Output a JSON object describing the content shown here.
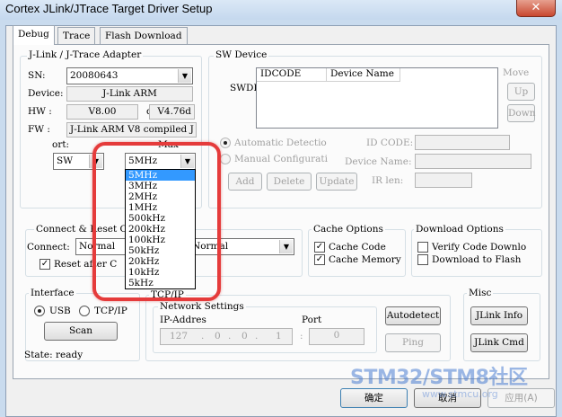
{
  "window": {
    "title": "Cortex JLink/JTrace Target Driver Setup",
    "close_glyph": "✕"
  },
  "tabs": [
    {
      "label": "Debug",
      "active": true
    },
    {
      "label": "Trace",
      "active": false
    },
    {
      "label": "Flash Download",
      "active": false
    }
  ],
  "adapter": {
    "title": "J-Link / J-Trace Adapter",
    "sn_label": "SN:",
    "sn_value": "20080643",
    "device_label": "Device:",
    "device_value": "J-Link ARM",
    "hw_label": "HW :",
    "hw_value": "V8.00",
    "dll_label": "dll",
    "dll_value": "V4.76d",
    "fw_label": "FW :",
    "fw_value": "J-Link ARM V8 compiled J",
    "port_label": "ort:",
    "port_value": "SW",
    "max_label": "Max",
    "max_value": "5MHz"
  },
  "clock_dropdown": {
    "options": [
      "5MHz",
      "3MHz",
      "2MHz",
      "1MHz",
      "500kHz",
      "200kHz",
      "100kHz",
      "50kHz",
      "20kHz",
      "10kHz",
      "5kHz"
    ],
    "selected": "5MHz"
  },
  "sw_device": {
    "title": "SW Device",
    "swdi_label": "SWDI",
    "col_idcode": "IDCODE",
    "col_device_name": "Device Name",
    "move_label": "Move",
    "up_button": "Up",
    "down_button": "Down",
    "auto_detect_label": "Automatic Detectio",
    "manual_config_label": "Manual Configurati",
    "id_code_label": "ID CODE:",
    "device_name_label": "Device Name:",
    "ir_len_label": "IR len:",
    "add_button": "Add",
    "delete_button": "Delete",
    "update_button": "Update"
  },
  "connect_reset": {
    "title": "Connect & Reset O",
    "connect_label": "Connect:",
    "connect_value": "Normal",
    "reset_value": "Normal",
    "reset_after_label": "Reset after C",
    "reset_after_checked": true
  },
  "cache": {
    "title": "Cache Options",
    "cache_code_label": "Cache Code",
    "cache_code_checked": true,
    "cache_memory_label": "Cache Memory",
    "cache_memory_checked": true
  },
  "download": {
    "title": "Download Options",
    "verify_label": "Verify Code Downlo",
    "verify_checked": false,
    "download_flash_label": "Download to Flash",
    "download_flash_checked": false
  },
  "interface": {
    "title": "Interface",
    "usb_label": "USB",
    "tcpip_label": "TCP/IP",
    "selected": "USB",
    "scan_button": "Scan",
    "state_label": "State: ready"
  },
  "tcpip": {
    "title": "TCP/IP",
    "network_title": "Network Settings",
    "ip_label": "IP-Addres",
    "ip_octets": [
      "127",
      "0",
      "0",
      "1"
    ],
    "port_label": "Port",
    "port_value": "0",
    "autodetect_button": "Autodetect",
    "ping_button": "Ping"
  },
  "misc": {
    "title": "Misc",
    "jlink_info_button": "JLink Info",
    "jlink_cmd_button": "JLink Cmd"
  },
  "footer": {
    "ok_button": "确定",
    "cancel_button": "取消",
    "apply_button": "应用(A)"
  },
  "watermark": {
    "text": "STM32/STM8社区",
    "url": "www.stmcu.org"
  },
  "colors": {
    "highlight": "#e53b3b",
    "selection": "#3399ff",
    "watermark": "#4b7dd2"
  }
}
